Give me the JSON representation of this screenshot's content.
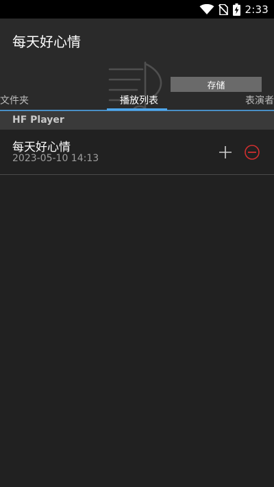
{
  "status_bar": {
    "time": "2:33",
    "icons": [
      "wifi-icon",
      "no-sim-icon",
      "battery-charging-icon"
    ]
  },
  "app_bar": {
    "title": "每天好心情",
    "storage_button_label": "存储"
  },
  "tabs": [
    {
      "label": "文件夹",
      "selected": false
    },
    {
      "label": "播放列表",
      "selected": true
    },
    {
      "label": "表演者",
      "selected": false
    }
  ],
  "playlist_section": {
    "header": "HF Player",
    "items": [
      {
        "title": "每天好心情",
        "date": "2023-05-10 14:13",
        "actions": [
          "add-icon",
          "remove-icon"
        ]
      }
    ]
  },
  "colors": {
    "background": "#212121",
    "app_bar": "#2a2a2a",
    "status_bar": "#000000",
    "accent_blue": "#4fa7ec",
    "remove_red": "#d32f2f",
    "button_gray": "#6a6a6a"
  }
}
